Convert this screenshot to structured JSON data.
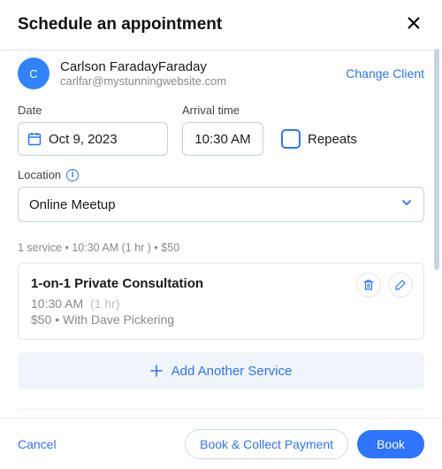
{
  "header": {
    "title": "Schedule an appointment"
  },
  "client": {
    "initial": "c",
    "name": "Carlson FaradayFaraday",
    "email": "carlfar@mystunningwebsite.com",
    "change_label": "Change Client"
  },
  "fields": {
    "date_label": "Date",
    "date_value": "Oct 9, 2023",
    "time_label": "Arrival time",
    "time_value": "10:30 AM",
    "repeats_label": "Repeats",
    "location_label": "Location",
    "location_value": "Online Meetup"
  },
  "summary": "1 service • 10:30 AM (1 hr ) • $50",
  "service": {
    "title": "1-on-1 Private Consultation",
    "time": "10:30 AM",
    "duration": "(1 hr)",
    "price_staff": "$50 • With Dave Pickering"
  },
  "add_service_label": "Add Another Service",
  "footer": {
    "cancel": "Cancel",
    "collect": "Book & Collect Payment",
    "book": "Book"
  }
}
